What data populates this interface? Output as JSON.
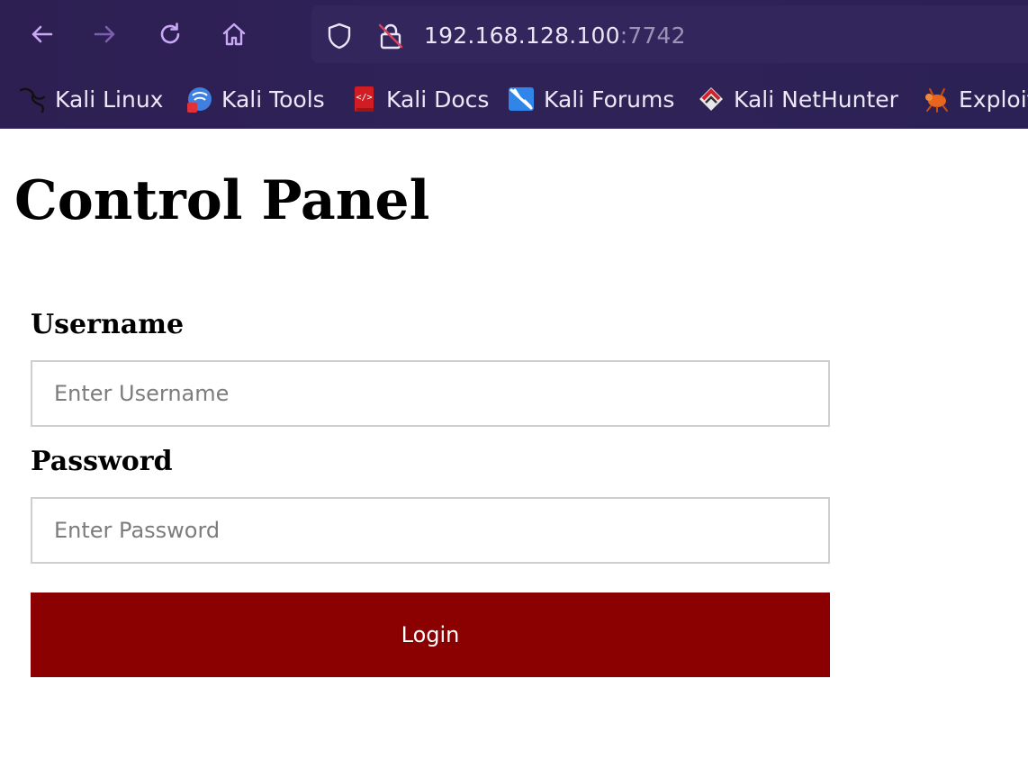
{
  "browser": {
    "url_host": "192.168.128.100",
    "url_port": ":7742",
    "bookmarks": [
      {
        "label": "Kali Linux",
        "icon": "kali-dragon-icon"
      },
      {
        "label": "Kali Tools",
        "icon": "kali-tools-icon"
      },
      {
        "label": "Kali Docs",
        "icon": "kali-docs-icon"
      },
      {
        "label": "Kali Forums",
        "icon": "kali-forums-icon"
      },
      {
        "label": "Kali NetHunter",
        "icon": "kali-nethunter-icon"
      },
      {
        "label": "Exploit",
        "icon": "exploit-db-icon"
      }
    ],
    "colors": {
      "chrome_bg": "#2d1f52",
      "nav_icon": "#c9a8f5"
    }
  },
  "page": {
    "title": "Control Panel",
    "username_label": "Username",
    "username_placeholder": "Enter Username",
    "password_label": "Password",
    "password_placeholder": "Enter Password",
    "login_label": "Login",
    "colors": {
      "login_button": "#8b0000"
    }
  }
}
